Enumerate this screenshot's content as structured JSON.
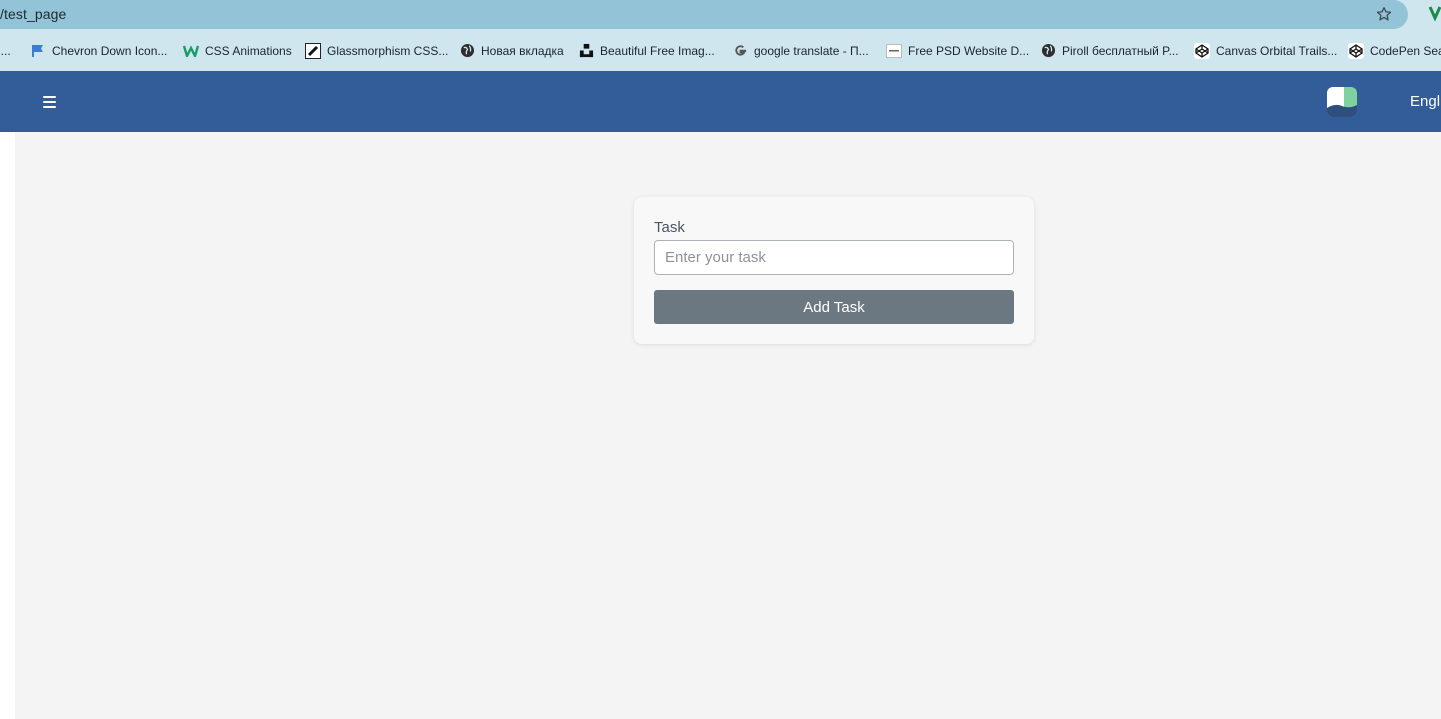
{
  "browser": {
    "url": "/test_page",
    "bookmarks": [
      {
        "label": "n...",
        "icon": "none"
      },
      {
        "label": "Chevron Down Icon...",
        "icon": "flag-icon"
      },
      {
        "label": "CSS Animations",
        "icon": "w-logo-icon"
      },
      {
        "label": "Glassmorphism CSS...",
        "icon": "pen-icon"
      },
      {
        "label": "Новая вкладка",
        "icon": "globe-icon"
      },
      {
        "label": "Beautiful Free Imag...",
        "icon": "unsplash-icon"
      },
      {
        "label": "google translate - П...",
        "icon": "google-icon"
      },
      {
        "label": "Free PSD Website D...",
        "icon": "psd-site-icon"
      },
      {
        "label": "Piroll бесплатный P...",
        "icon": "globe-icon"
      },
      {
        "label": "Canvas Orbital Trails...",
        "icon": "codepen-icon"
      },
      {
        "label": "CodePen Sea",
        "icon": "codepen-icon"
      }
    ]
  },
  "header": {
    "menu_icon": "hamburger-icon",
    "logo_icon": "app-logo-icon",
    "language": "Engl",
    "color": "#325d99"
  },
  "form": {
    "task_label": "Task",
    "task_placeholder": "Enter your task",
    "task_value": "",
    "add_button_label": "Add Task",
    "button_color": "#6b7882"
  }
}
